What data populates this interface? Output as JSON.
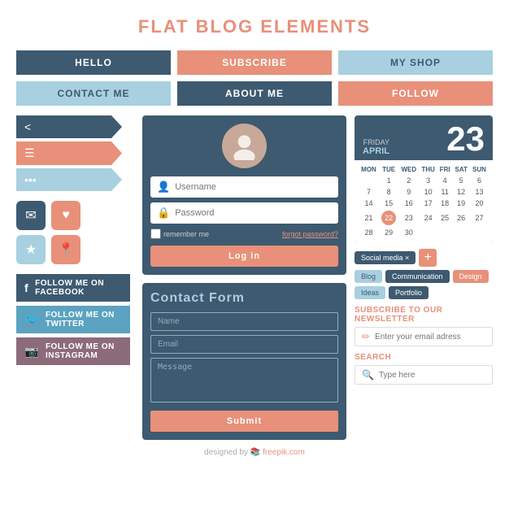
{
  "title": "FLAT BLOG ELEMENTS",
  "topNav": {
    "btn1": "HELLO",
    "btn2": "SUBSCRIBE",
    "btn3": "MY SHOP",
    "btn4": "CONTACT ME",
    "btn5": "ABOUT ME",
    "btn6": "FOLLOW"
  },
  "ribbons": {
    "share": "share",
    "menu": "menu",
    "dots": "dots"
  },
  "social": {
    "facebook": "FOLLOW ME ON FACEBOOK",
    "twitter": "FOLLOW ME ON TWITTER",
    "instagram": "FOLLOW ME ON INSTAGRAM"
  },
  "login": {
    "username_placeholder": "Username",
    "password_placeholder": "Password",
    "remember": "remember me",
    "forgot": "forgot password?",
    "btn": "Log in"
  },
  "contactForm": {
    "title": "Contact Form",
    "name_placeholder": "Name",
    "email_placeholder": "Email",
    "message_placeholder": "Message",
    "submit": "Submit"
  },
  "calendar": {
    "day": "FRIDAY",
    "month": "APRIL",
    "date": "23",
    "headers": [
      "MON",
      "TUE",
      "WED",
      "THU",
      "FRI",
      "SAT",
      "SUN"
    ],
    "weeks": [
      [
        "",
        "1",
        "2",
        "3",
        "4",
        "5",
        "6",
        "7"
      ],
      [
        "",
        "8",
        "9",
        "10",
        "11",
        "12",
        "13",
        "14"
      ],
      [
        "",
        "15",
        "16",
        "17",
        "18",
        "19",
        "20",
        "21"
      ],
      [
        "",
        "22",
        "23",
        "24",
        "25",
        "26",
        "27",
        "28"
      ],
      [
        "",
        "29",
        "30",
        "",
        "",
        "",
        "",
        ""
      ]
    ],
    "todayDate": "22"
  },
  "tags": {
    "active": "Social media ×",
    "items": [
      "Blog",
      "Communication",
      "Design",
      "Ideas",
      "Portfolio"
    ]
  },
  "newsletter": {
    "title": "SUBSCRIBE TO OUR NEWSLETTER",
    "placeholder": "Enter your email adress"
  },
  "search": {
    "title": "SEARCH",
    "placeholder": "Type here"
  },
  "footer": "designed by freepik.com"
}
